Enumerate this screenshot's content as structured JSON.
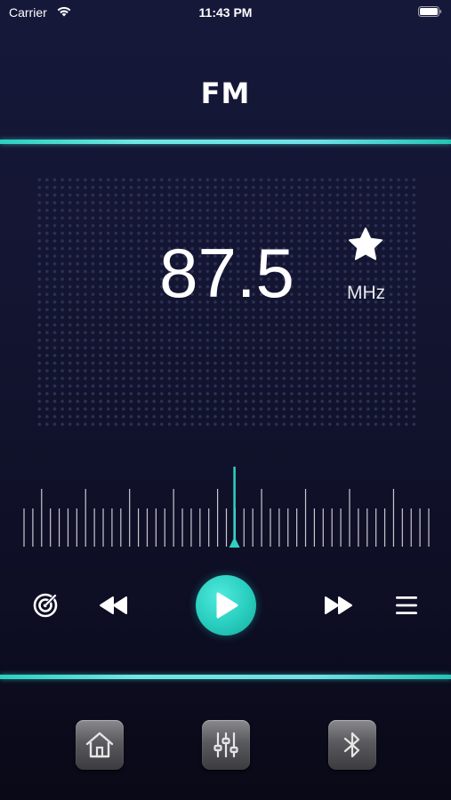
{
  "status_bar": {
    "carrier": "Carrier",
    "time": "11:43 PM"
  },
  "header": {
    "title": "FM"
  },
  "display": {
    "frequency": "87.5",
    "unit": "MHz",
    "favorite_icon": "star-icon"
  },
  "tuner": {
    "position_fraction": 0.52
  },
  "controls": {
    "scan_icon": "radar-icon",
    "previous_icon": "rewind-icon",
    "play_icon": "play-icon",
    "next_icon": "fast-forward-icon",
    "list_icon": "list-icon"
  },
  "tab_bar": {
    "items": [
      {
        "icon": "home-icon"
      },
      {
        "icon": "equalizer-icon"
      },
      {
        "icon": "bluetooth-icon"
      }
    ]
  },
  "colors": {
    "accent": "#2ccfbf",
    "background_top": "#16183a",
    "background_bottom": "#0a0917"
  }
}
